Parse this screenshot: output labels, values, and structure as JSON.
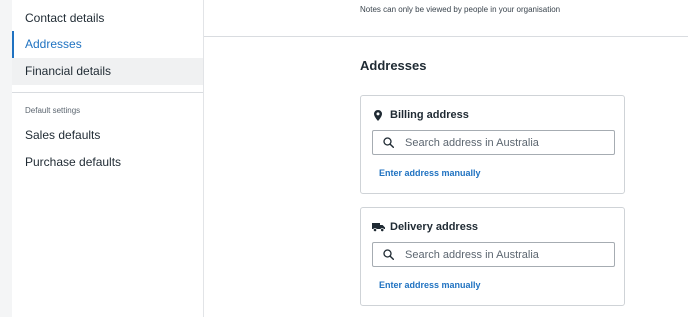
{
  "sidebar": {
    "items": [
      {
        "label": "Contact details"
      },
      {
        "label": "Addresses"
      },
      {
        "label": "Financial details"
      },
      {
        "label": "Sales defaults"
      },
      {
        "label": "Purchase defaults"
      }
    ],
    "section_heading": "Default settings"
  },
  "main": {
    "notes_text": "Notes can only be viewed by people in your organisation",
    "section_title": "Addresses",
    "billing": {
      "title": "Billing address",
      "search_placeholder": "Search address in Australia",
      "manual_link": "Enter address manually",
      "icon": "map-pin-icon"
    },
    "delivery": {
      "title": "Delivery address",
      "search_placeholder": "Search address in Australia",
      "manual_link": "Enter address manually",
      "icon": "truck-icon"
    }
  },
  "colors": {
    "accent": "#1f72c1",
    "text": "#1f2a33",
    "border": "#cfd3d7"
  }
}
